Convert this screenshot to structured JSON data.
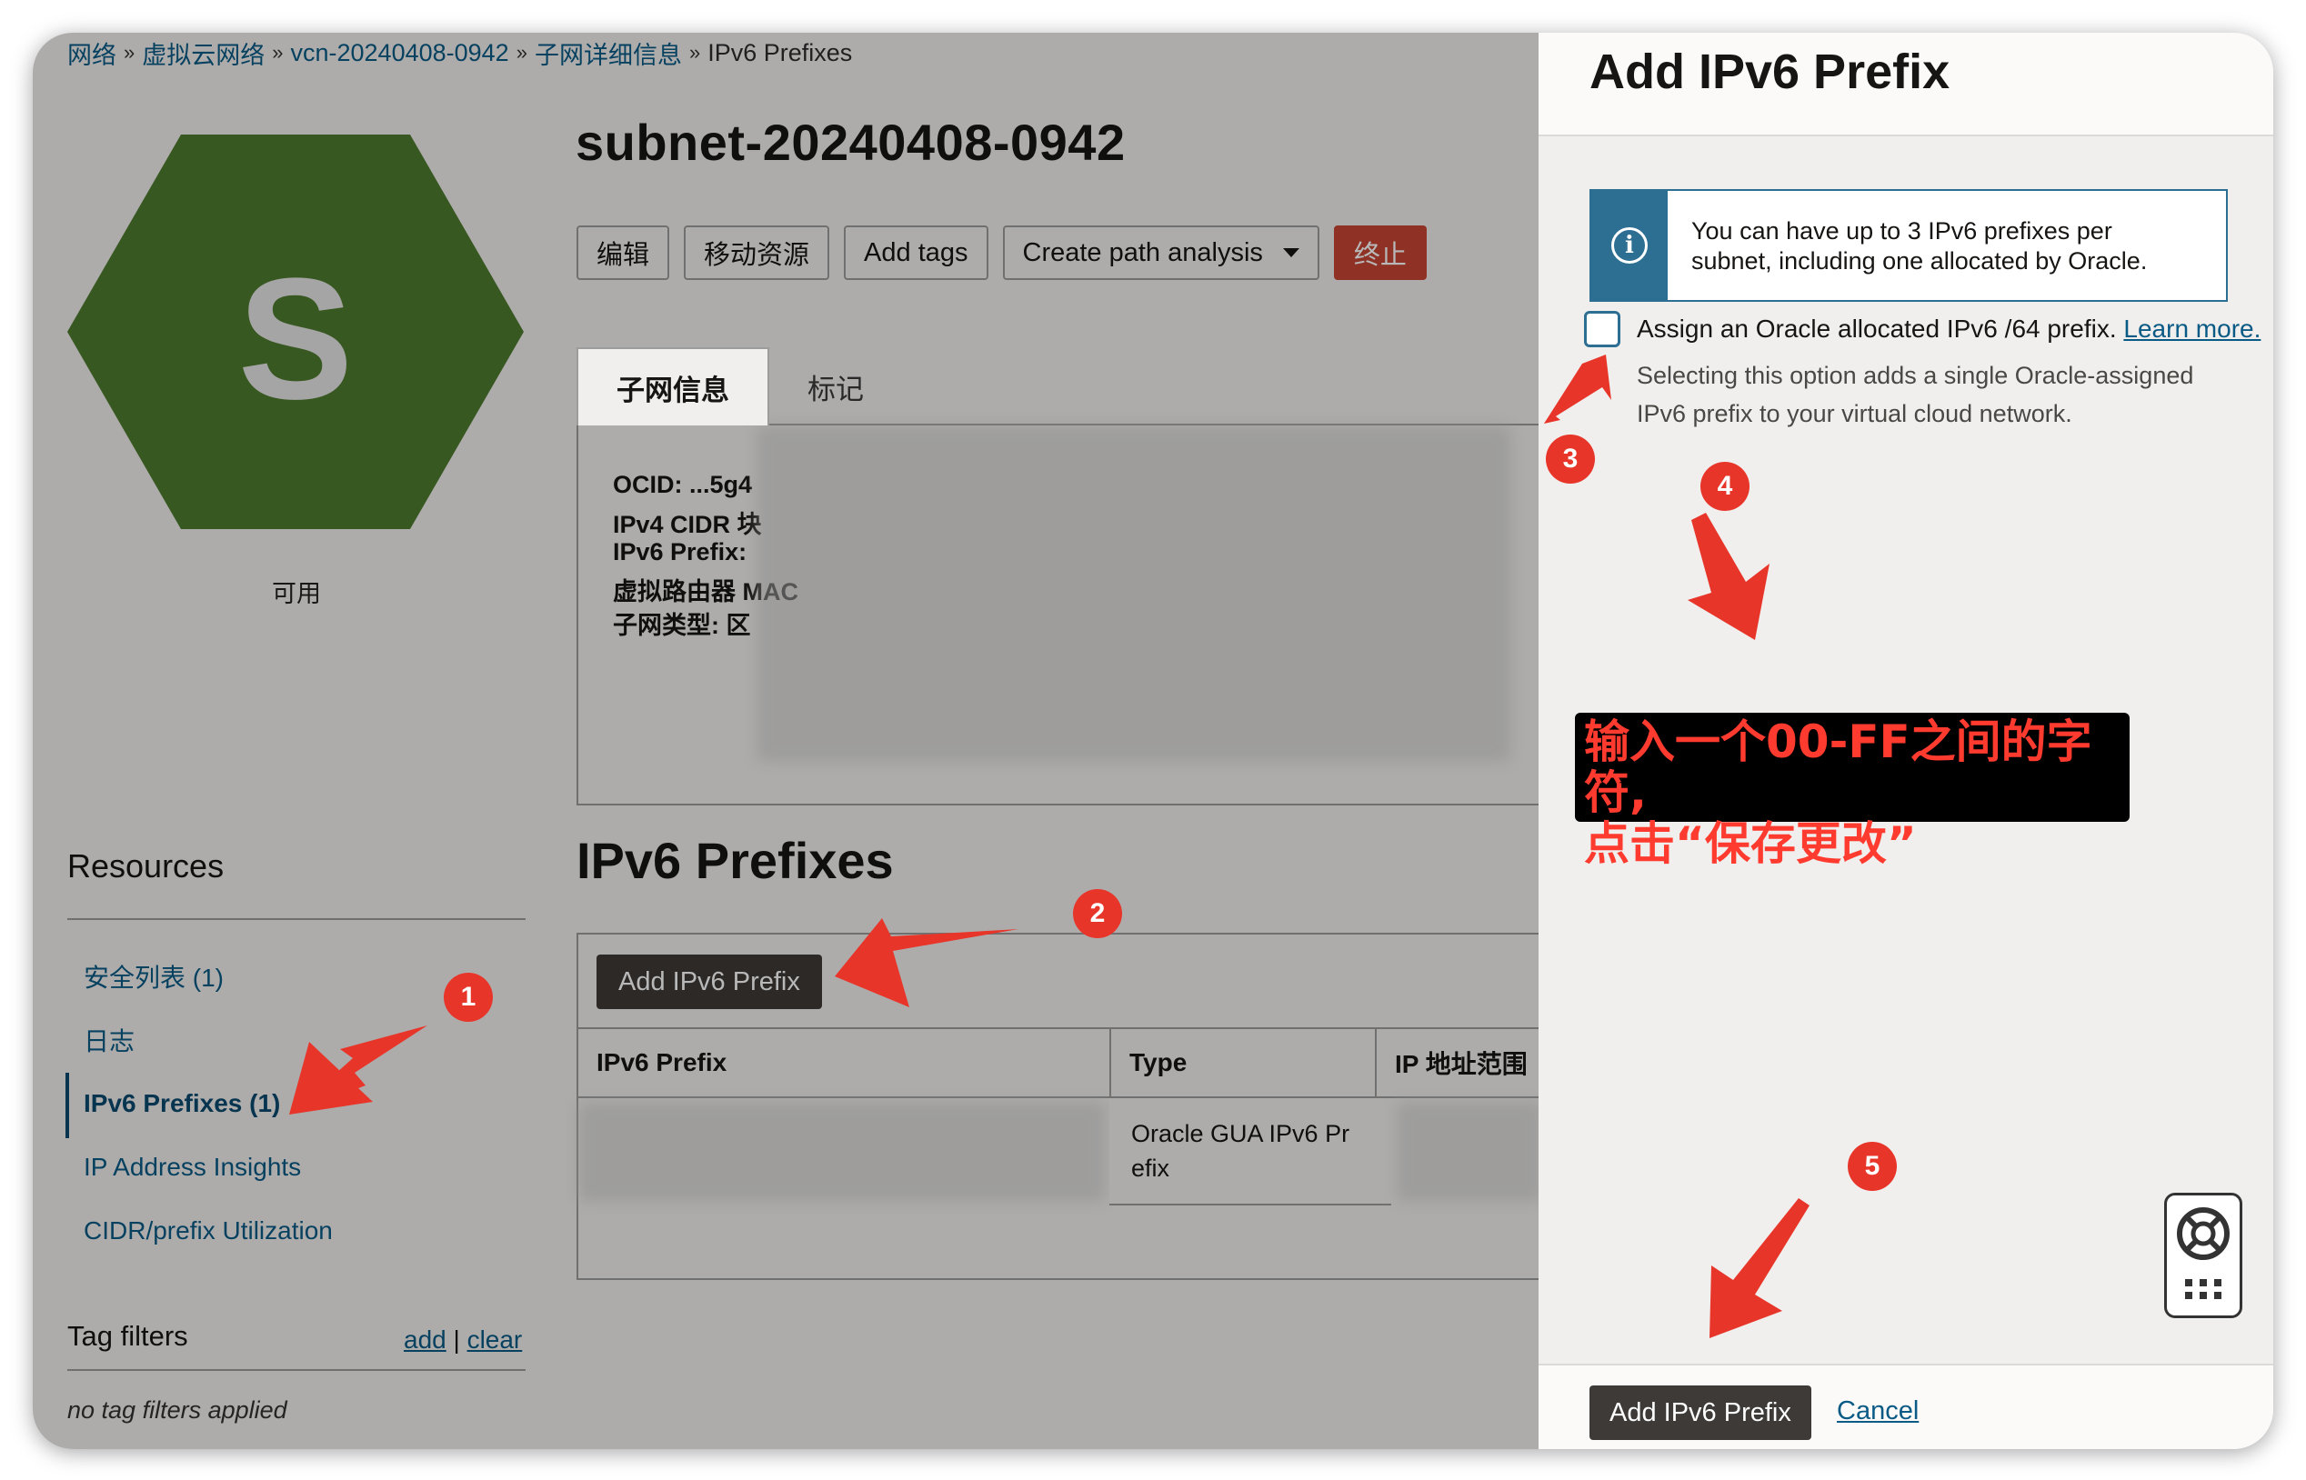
{
  "breadcrumb": {
    "items": [
      "网络",
      "虚拟云网络",
      "vcn-20240408-0942",
      "子网详细信息"
    ],
    "current": "IPv6 Prefixes",
    "separator": "»"
  },
  "resource": {
    "icon_letter": "S",
    "status": "可用",
    "title": "subnet-20240408-0942"
  },
  "actions": {
    "edit": "编辑",
    "move": "移动资源",
    "add_tags": "Add tags",
    "path_analysis": "Create path analysis",
    "terminate": "终止"
  },
  "tabs": [
    "子网信息",
    "标记"
  ],
  "details": {
    "ocid": "OCID: ...5g4",
    "ipv4": "IPv4 CIDR 块",
    "ipv6": "IPv6 Prefix:",
    "router": "虚拟路由器 MAC",
    "type": "子网类型: 区"
  },
  "section": {
    "title": "IPv6 Prefixes",
    "add_button": "Add IPv6 Prefix",
    "columns": [
      "IPv6 Prefix",
      "Type",
      "IP 地址范围"
    ],
    "rows": [
      {
        "type": "Oracle GUA IPv6 Prefix",
        "type_line1": "Oracle GUA IPv6 Pr",
        "type_line2": "efix"
      }
    ]
  },
  "resources": {
    "title": "Resources",
    "items": [
      "安全列表 (1)",
      "日志",
      "IPv6 Prefixes (1)",
      "IP Address Insights",
      "CIDR/prefix Utilization"
    ],
    "active": "IPv6 Prefixes (1)"
  },
  "tag_filters": {
    "label": "Tag filters",
    "add": "add",
    "divider": "|",
    "clear": "clear",
    "empty": "no tag filters applied"
  },
  "drawer": {
    "title": "Add IPv6 Prefix",
    "info_line1": "You can have up to 3 IPv6 prefixes per",
    "info_line2": "subnet, including one allocated by Oracle.",
    "checkbox_label": "Assign an Oracle allocated IPv6 /64 prefix.",
    "learn_more": "Learn more.",
    "help_line1": "Selecting this option adds a single Oracle-assigned",
    "help_line2": "IPv6 prefix to your virtual cloud network.",
    "checkbox_checked": false,
    "submit": "Add IPv6 Prefix",
    "cancel": "Cancel"
  },
  "annotations": {
    "steps": [
      "1",
      "2",
      "3",
      "4",
      "5"
    ],
    "note_line1": "输入一个00-FF之间的字符,",
    "note_line2": "点击“保存更改”",
    "arrow_color": "#e8352a"
  },
  "colors": {
    "hexagon": "#4e7a2f",
    "danger": "#c74634",
    "link": "#0a5a86",
    "accent": "#2d6f93"
  }
}
